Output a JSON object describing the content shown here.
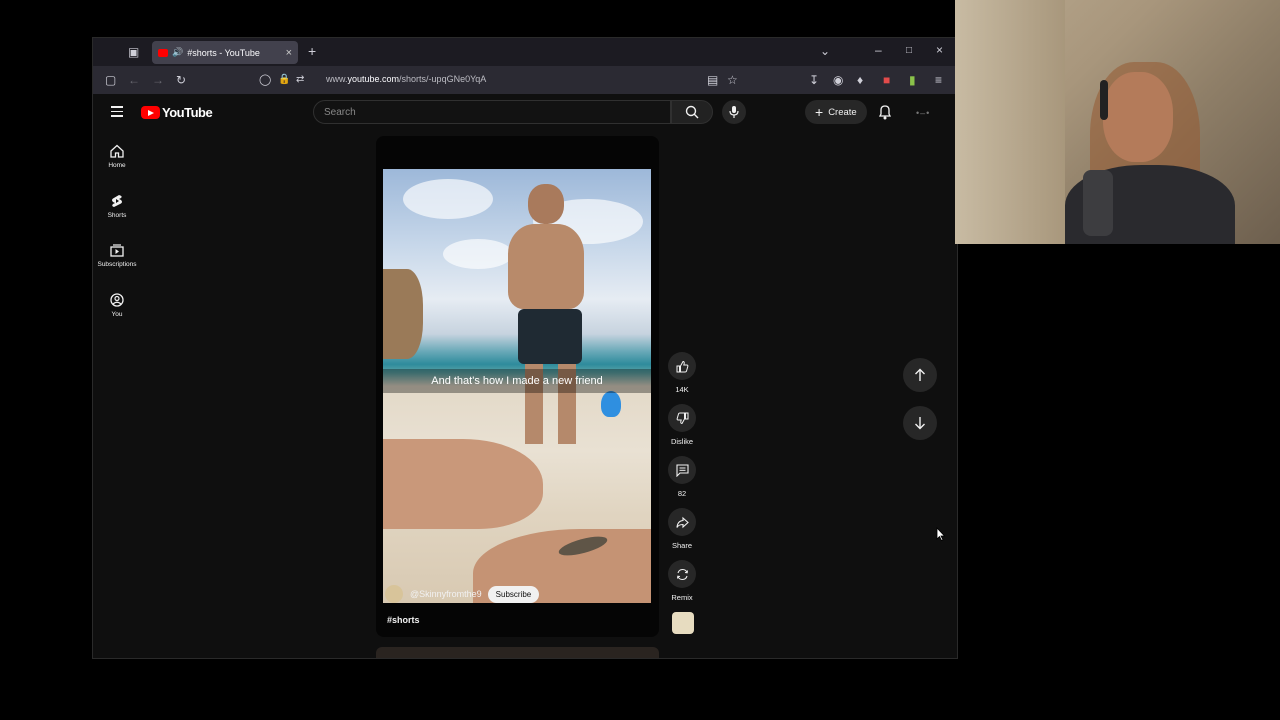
{
  "browser": {
    "tab_title": "#shorts - YouTube",
    "url_prefix": "www.",
    "url_domain": "youtube.com",
    "url_path": "/shorts/-upqGNe0YqA"
  },
  "yt": {
    "logo_text": "YouTube",
    "search_placeholder": "Search",
    "create_label": "Create"
  },
  "sidebar": {
    "items": [
      {
        "label": "Home"
      },
      {
        "label": "Shorts"
      },
      {
        "label": "Subscriptions"
      },
      {
        "label": "You"
      }
    ]
  },
  "short": {
    "caption": "And that's how I made a new friend",
    "channel": "@Skinnyfromthe9",
    "subscribe_label": "Subscribe",
    "hashtag": "#shorts"
  },
  "actions": {
    "like_count": "14K",
    "dislike_label": "Dislike",
    "comment_count": "82",
    "share_label": "Share",
    "remix_label": "Remix"
  },
  "colors": {
    "accent": "#ff0000",
    "background": "#0f0f0f",
    "chip": "#272727"
  }
}
